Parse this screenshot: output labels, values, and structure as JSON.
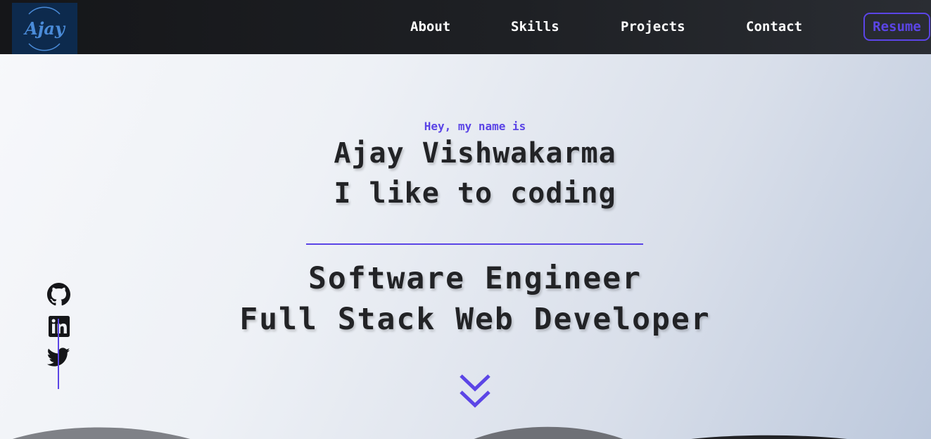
{
  "navbar": {
    "logo_text": "Ajay",
    "links": [
      {
        "label": "About"
      },
      {
        "label": "Skills"
      },
      {
        "label": "Projects"
      },
      {
        "label": "Contact"
      }
    ],
    "resume_label": "Resume"
  },
  "hero": {
    "greeting": "Hey, my name is",
    "name": "Ajay Vishwakarma",
    "tagline": "I like to coding",
    "roles": [
      "Software Engineer",
      "Full Stack Web Developer"
    ]
  },
  "social": [
    {
      "icon": "github-icon"
    },
    {
      "icon": "linkedin-icon"
    },
    {
      "icon": "twitter-icon"
    }
  ],
  "colors": {
    "accent": "#5b45e6",
    "navbar_bg": "#1e2024",
    "text_dark": "#222326",
    "logo_bg": "#0d2a4d",
    "logo_text": "#4a8bd8"
  }
}
